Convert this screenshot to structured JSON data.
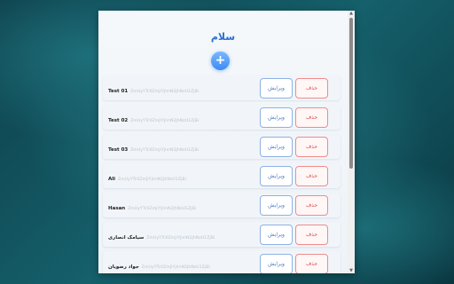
{
  "app": {
    "title": "سلام",
    "add_label": "+"
  },
  "buttons": {
    "edit_label": "ویرایش",
    "delete_label": "حذف"
  },
  "rows": [
    {
      "name": "Test 01",
      "key": "ZmUyYTc0ZmJiYjlmN2JhNzU1ZjBi"
    },
    {
      "name": "Test 02",
      "key": "ZmUyYTc0ZmJiYjlmN2JhNzU1ZjBi"
    },
    {
      "name": "Test 03",
      "key": "ZmUyYTc0ZmJiYjlmN2JhNzU1ZjBi"
    },
    {
      "name": "Ali",
      "key": "ZmUyYTc0ZmJiYjlmN2JhNzU1ZjBi"
    },
    {
      "name": "Hasan",
      "key": "ZmUyYTc0ZmJiYjlmN2JhNzU1ZjBi"
    },
    {
      "name": "سیامک انصاری",
      "key": "ZmUyYTc0ZmJiYjlmN2JhNzU1ZjBi"
    },
    {
      "name": "جواد رضویان",
      "key": "ZmUyYTc0ZmJiYjlmN2JhNzU1ZjBi"
    }
  ],
  "scrollbar": {
    "up_glyph": "▲",
    "down_glyph": "▼"
  },
  "colors": {
    "accent": "#3d8bf0",
    "edit": "#4c78c4",
    "delete": "#d94848",
    "title": "#2f6fd0"
  }
}
